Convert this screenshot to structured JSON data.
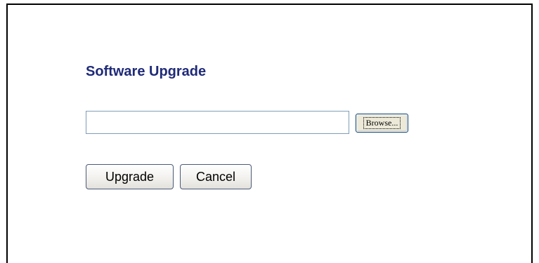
{
  "upgrade_form": {
    "title": "Software Upgrade",
    "file_input_value": "",
    "browse_label": "Browse...",
    "upgrade_label": "Upgrade",
    "cancel_label": "Cancel"
  }
}
